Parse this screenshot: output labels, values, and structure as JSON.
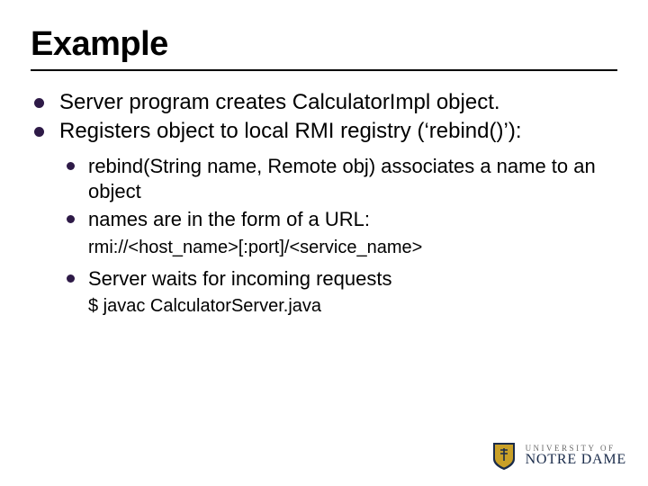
{
  "title": "Example",
  "bullets": {
    "top1": "Server program creates CalculatorImpl object.",
    "top2": "Registers object to local RMI registry (‘rebind()’):",
    "sub1": "rebind(String name, Remote obj) associates a name to an object",
    "sub2": "names are in the form of a URL:",
    "sub2_detail": "rmi://<host_name>[:port]/<service_name>",
    "sub3": "Server waits for incoming requests",
    "sub3_detail": "$ javac CalculatorServer.java"
  },
  "footer": {
    "univ": "UNIVERSITY OF",
    "name": "NOTRE DAME"
  }
}
